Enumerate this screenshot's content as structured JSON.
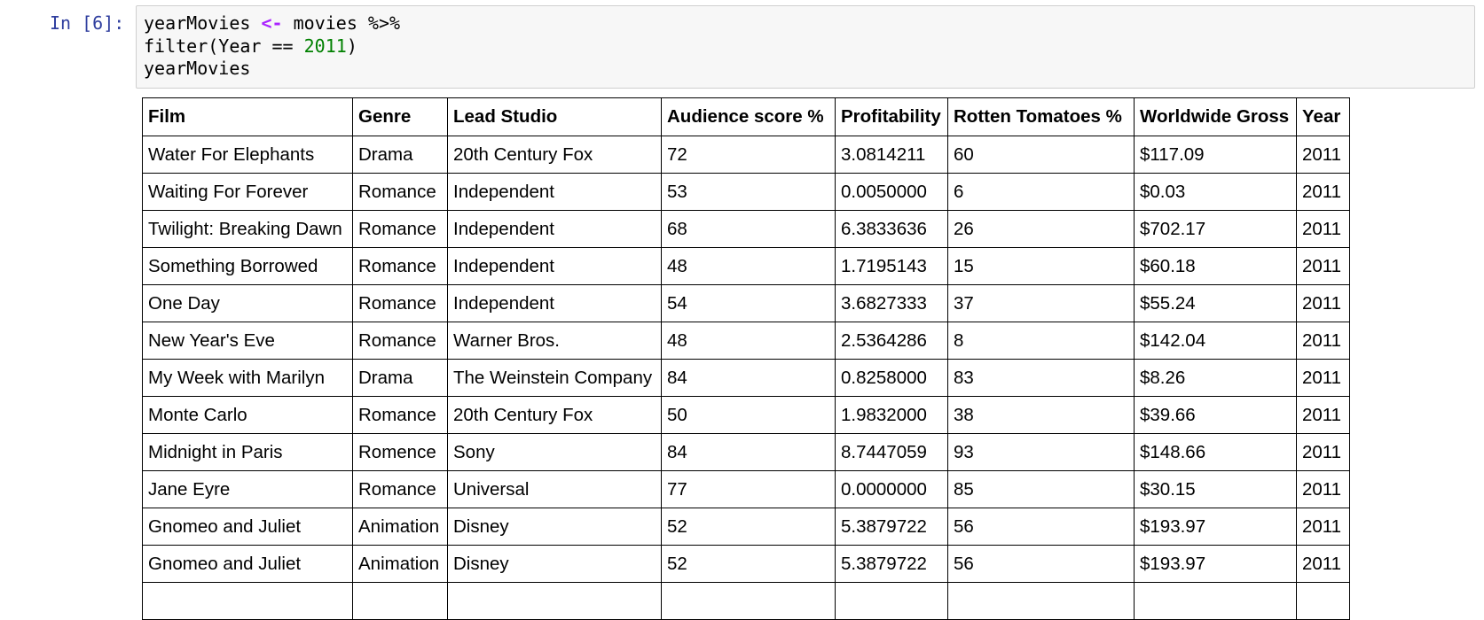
{
  "cell": {
    "prompt": "In [6]:",
    "code": {
      "line1": {
        "var": "yearMovies",
        "assign": "<-",
        "src": "movies",
        "pipe": "%>%"
      },
      "line2": {
        "call_open": "filter(Year ",
        "eq": "==",
        "num": "2011",
        "call_close": ")"
      },
      "line3": {
        "text": "yearMovies"
      }
    }
  },
  "output": {
    "columns": [
      "Film",
      "Genre",
      "Lead Studio",
      "Audience score %",
      "Profitability",
      "Rotten Tomatoes %",
      "Worldwide Gross",
      "Year"
    ],
    "rows": [
      [
        "Water For Elephants",
        "Drama",
        "20th Century Fox",
        "72",
        "3.0814211",
        "60",
        "$117.09",
        "2011"
      ],
      [
        "Waiting For Forever",
        "Romance",
        "Independent",
        "53",
        "0.0050000",
        "6",
        "$0.03",
        "2011"
      ],
      [
        "Twilight: Breaking Dawn",
        "Romance",
        "Independent",
        "68",
        "6.3833636",
        "26",
        "$702.17",
        "2011"
      ],
      [
        "Something Borrowed",
        "Romance",
        "Independent",
        "48",
        "1.7195143",
        "15",
        "$60.18",
        "2011"
      ],
      [
        "One Day",
        "Romance",
        "Independent",
        "54",
        "3.6827333",
        "37",
        "$55.24",
        "2011"
      ],
      [
        "New Year's Eve",
        "Romance",
        "Warner Bros.",
        "48",
        "2.5364286",
        "8",
        "$142.04",
        "2011"
      ],
      [
        "My Week with Marilyn",
        "Drama",
        "The Weinstein Company",
        "84",
        "0.8258000",
        "83",
        "$8.26",
        "2011"
      ],
      [
        "Monte Carlo",
        "Romance",
        "20th Century Fox",
        "50",
        "1.9832000",
        "38",
        "$39.66",
        "2011"
      ],
      [
        "Midnight in Paris",
        "Romence",
        "Sony",
        "84",
        "8.7447059",
        "93",
        "$148.66",
        "2011"
      ],
      [
        "Jane Eyre",
        "Romance",
        "Universal",
        "77",
        "0.0000000",
        "85",
        "$30.15",
        "2011"
      ],
      [
        "Gnomeo and Juliet",
        "Animation",
        "Disney",
        "52",
        "5.3879722",
        "56",
        "$193.97",
        "2011"
      ],
      [
        "Gnomeo and Juliet",
        "Animation",
        "Disney",
        "52",
        "5.3879722",
        "56",
        "$193.97",
        "2011"
      ],
      [
        "",
        "",
        "",
        "",
        "",
        "",
        "",
        ""
      ]
    ]
  }
}
